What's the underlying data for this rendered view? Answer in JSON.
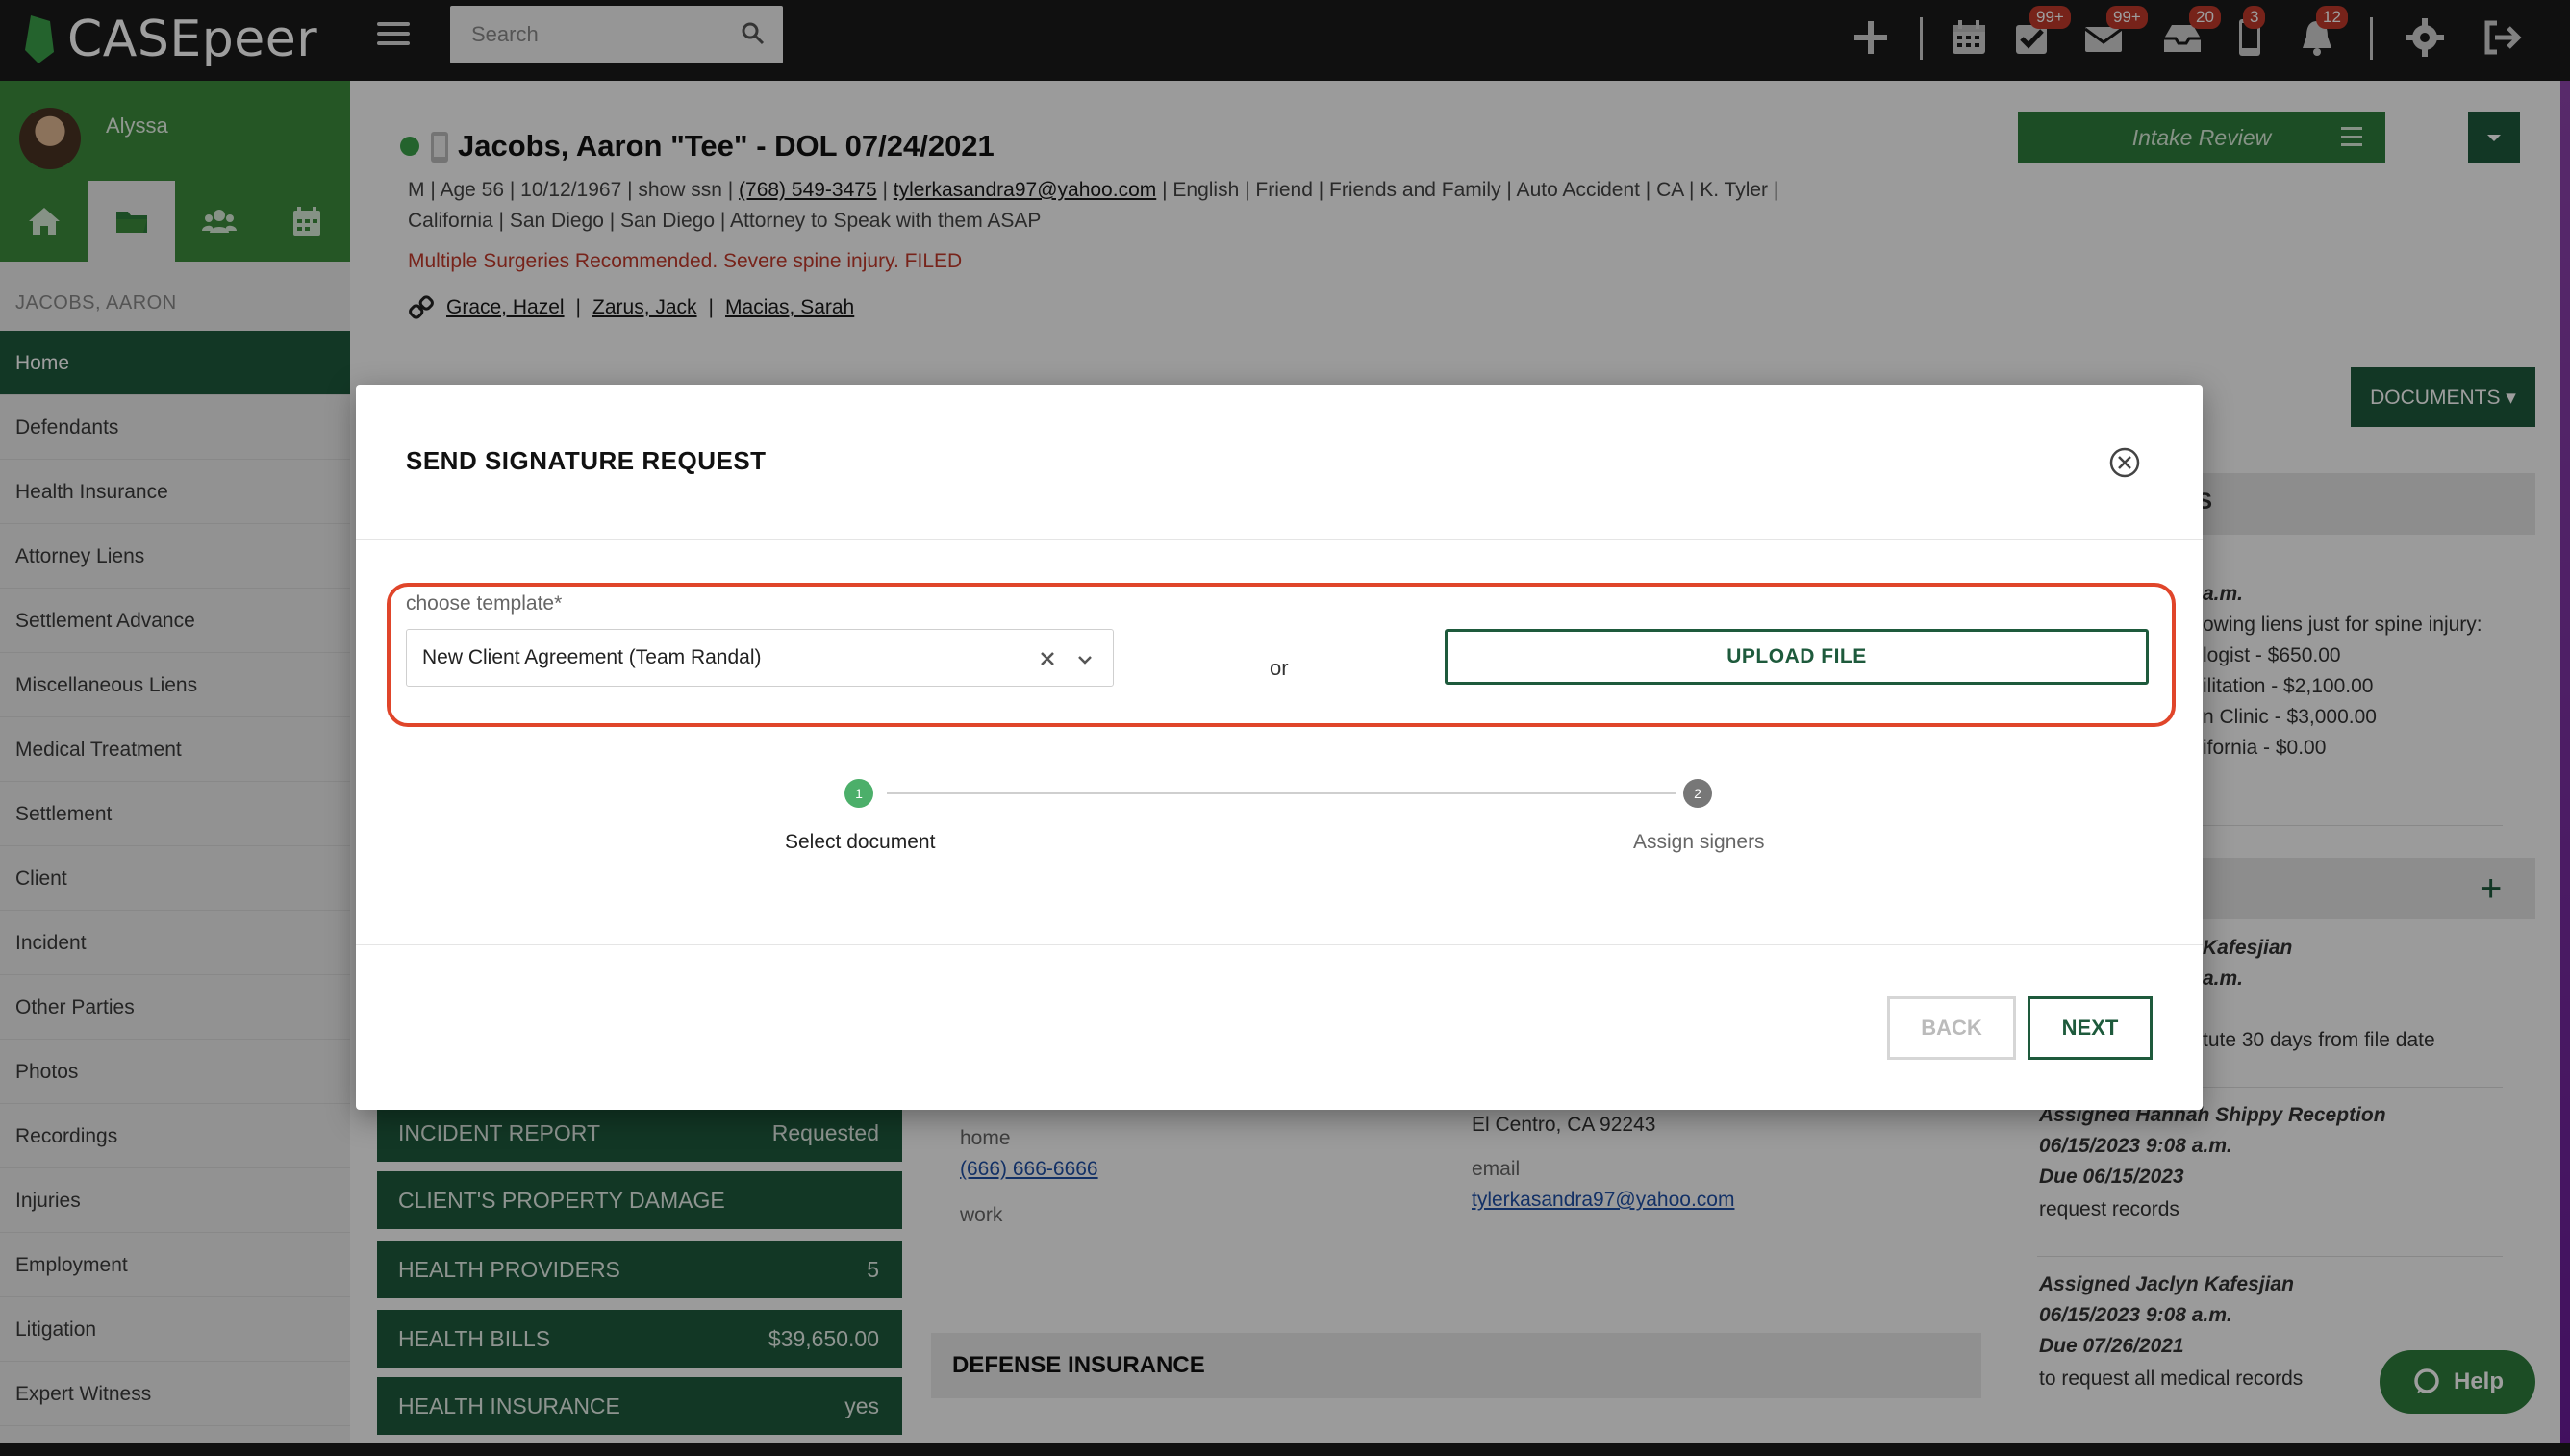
{
  "app": {
    "name": "CASEpeer"
  },
  "search": {
    "placeholder": "Search"
  },
  "badges": {
    "tasks": "99+",
    "mail": "99+",
    "inbox": "20",
    "phone": "3",
    "notifications": "12"
  },
  "user": {
    "name": "Alyssa"
  },
  "sidebar": {
    "client_label": "JACOBS, AARON",
    "items": [
      "Home",
      "Defendants",
      "Health Insurance",
      "Attorney Liens",
      "Settlement Advance",
      "Miscellaneous Liens",
      "Medical Treatment",
      "Settlement",
      "Client",
      "Incident",
      "Other Parties",
      "Photos",
      "Recordings",
      "Injuries",
      "Employment",
      "Litigation",
      "Expert Witness"
    ]
  },
  "case": {
    "title": "Jacobs, Aaron \"Tee\" - DOL 07/24/2021",
    "info_line1": "M  |  Age 56   |  10/12/1967  |  show ssn  | ",
    "phone": "(768) 549-3475",
    "email": "tylerkasandra97@yahoo.com",
    "info_line1_tail": "  |  English  |  Friend  |  Friends and Family  |  Auto Accident  |  CA  |  K. Tyler  |",
    "info_line2": "California  |  San Diego  |  San Diego  |  Attorney to Speak with them ASAP",
    "alert": "Multiple Surgeries Recommended. Severe spine injury. FILED",
    "related": [
      "Grace, Hazel",
      "Zarus, Jack",
      "Macias, Sarah"
    ]
  },
  "header_buttons": {
    "intake_review": "Intake Review",
    "documents": "DOCUMENTS ▾"
  },
  "right_panel": {
    "head_fragment": "S",
    "lines": [
      "a.m.",
      "owing liens just for spine injury:",
      "logist - $650.00",
      "ilitation - $2,100.00",
      "n Clinic - $3,000.00",
      "ifornia - $0.00"
    ],
    "task1": [
      "Kafesjian",
      "a.m."
    ],
    "task1_note": "tute 30 days from file date",
    "task2": {
      "assigned": "Assigned Hannah Shippy Reception",
      "time": "06/15/2023 9:08 a.m.",
      "due": "Due 06/15/2023",
      "note": "request records"
    },
    "task3": {
      "assigned": "Assigned Jaclyn Kafesjian",
      "time": "06/15/2023 9:08 a.m.",
      "due": "Due 07/26/2021",
      "note": "to request all medical records"
    }
  },
  "tiles": [
    {
      "label": "INCIDENT REPORT",
      "value": "Requested"
    },
    {
      "label": "CLIENT'S PROPERTY DAMAGE",
      "value": ""
    },
    {
      "label": "HEALTH PROVIDERS",
      "value": "5"
    },
    {
      "label": "HEALTH BILLS",
      "value": "$39,650.00"
    },
    {
      "label": "HEALTH INSURANCE",
      "value": "yes"
    }
  ],
  "contact": {
    "home_label": "home",
    "home_phone": "(666) 666-6666",
    "work_label": "work",
    "address": "El Centro, CA 92243",
    "email_label": "email",
    "email": "tylerkasandra97@yahoo.com"
  },
  "defense_insurance": "DEFENSE INSURANCE",
  "help": "Help",
  "modal": {
    "title": "SEND SIGNATURE REQUEST",
    "template_label": "choose template",
    "required_mark": "*",
    "template_value": "New Client Agreement (Team Randal)",
    "or": "or",
    "upload": "UPLOAD FILE",
    "steps": [
      {
        "num": "1",
        "label": "Select document"
      },
      {
        "num": "2",
        "label": "Assign signers"
      }
    ],
    "back": "BACK",
    "next": "NEXT"
  },
  "colors": {
    "brand_green": "#2e7d3c",
    "dark_green": "#1e5a3c",
    "alert_red": "#c0392b",
    "highlight": "#e0452a"
  }
}
